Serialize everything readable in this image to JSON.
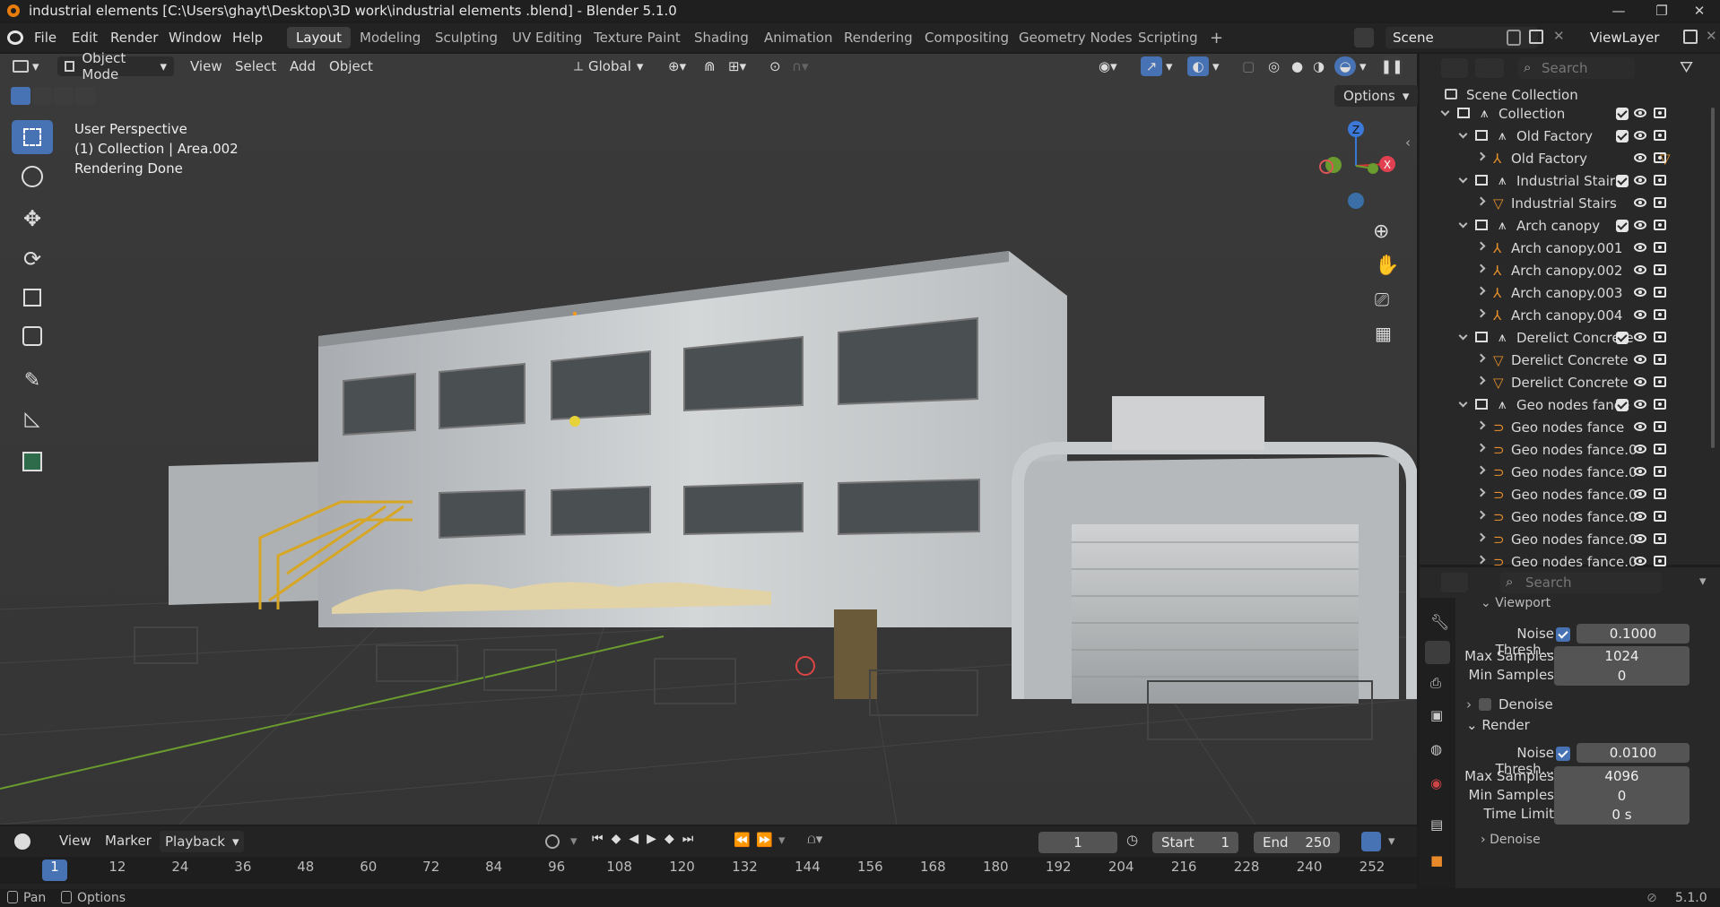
{
  "window": {
    "title": "industrial elements  [C:\\Users\\ghayt\\Desktop\\3D work\\industrial elements .blend] - Blender 5.1.0"
  },
  "menu": [
    "File",
    "Edit",
    "Render",
    "Window",
    "Help"
  ],
  "workspaces": [
    "Layout",
    "Modeling",
    "Sculpting",
    "UV Editing",
    "Texture Paint",
    "Shading",
    "Animation",
    "Rendering",
    "Compositing",
    "Geometry Nodes",
    "Scripting"
  ],
  "active_workspace": "Layout",
  "scene": {
    "name": "Scene",
    "view_layer": "ViewLayer"
  },
  "viewport": {
    "mode": "Object Mode",
    "menus": [
      "View",
      "Select",
      "Add",
      "Object"
    ],
    "orientation": "Global",
    "options_label": "Options",
    "overlay_lines": [
      "User Perspective",
      "(1) Collection | Area.002",
      "Rendering Done"
    ],
    "gizmo": {
      "z": "Z",
      "x": "X"
    }
  },
  "outliner": {
    "search_placeholder": "Search",
    "root": "Scene Collection",
    "rows": [
      {
        "name": "Collection",
        "kind": "collection",
        "level": 0,
        "check": true
      },
      {
        "name": "Old Factory",
        "kind": "collection",
        "level": 1,
        "check": true
      },
      {
        "name": "Old Factory",
        "kind": "armature",
        "level": 2,
        "extra": "modifier-icon"
      },
      {
        "name": "Industrial Stairs",
        "kind": "collection",
        "level": 1,
        "check": true
      },
      {
        "name": "Industrial Stairs",
        "kind": "mesh",
        "level": 2
      },
      {
        "name": "Arch canopy",
        "kind": "collection",
        "level": 1,
        "check": true
      },
      {
        "name": "Arch canopy.001",
        "kind": "armature",
        "level": 2
      },
      {
        "name": "Arch canopy.002",
        "kind": "armature",
        "level": 2
      },
      {
        "name": "Arch canopy.003",
        "kind": "armature",
        "level": 2
      },
      {
        "name": "Arch canopy.004",
        "kind": "armature",
        "level": 2
      },
      {
        "name": "Derelict Concrete",
        "kind": "collection",
        "level": 1,
        "check": true
      },
      {
        "name": "Derelict Concrete",
        "kind": "mesh",
        "level": 2
      },
      {
        "name": "Derelict Concrete",
        "kind": "mesh",
        "level": 2
      },
      {
        "name": "Geo nodes fance",
        "kind": "collection",
        "level": 1,
        "check": true
      },
      {
        "name": "Geo nodes fance",
        "kind": "curve",
        "level": 2
      },
      {
        "name": "Geo nodes fance.0",
        "kind": "curve",
        "level": 2
      },
      {
        "name": "Geo nodes fance.0",
        "kind": "curve",
        "level": 2
      },
      {
        "name": "Geo nodes fance.0",
        "kind": "curve",
        "level": 2
      },
      {
        "name": "Geo nodes fance.0",
        "kind": "curve",
        "level": 2
      },
      {
        "name": "Geo nodes fance.0",
        "kind": "curve",
        "level": 2
      },
      {
        "name": "Geo nodes fance.0",
        "kind": "curve",
        "level": 2
      }
    ]
  },
  "properties": {
    "search_placeholder": "Search",
    "viewport_section": "Viewport",
    "viewport_noise_label": "Noise Thresh...",
    "viewport_noise_value": "0.1000",
    "viewport_max_label": "Max Samples",
    "viewport_max_value": "1024",
    "viewport_min_label": "Min Samples",
    "viewport_min_value": "0",
    "denoise_label": "Denoise",
    "render_section": "Render",
    "render_noise_label": "Noise Thresh...",
    "render_noise_value": "0.0100",
    "render_max_label": "Max Samples",
    "render_max_value": "4096",
    "render_min_label": "Min Samples",
    "render_min_value": "0",
    "time_limit_label": "Time Limit",
    "time_limit_value": "0 s",
    "denoise2_label": "Denoise"
  },
  "timeline": {
    "menus": [
      "View",
      "Marker"
    ],
    "playback": "Playback",
    "current_frame": "1",
    "start_label": "Start",
    "start": "1",
    "end_label": "End",
    "end": "250",
    "ticks": [
      "1",
      "12",
      "24",
      "36",
      "48",
      "60",
      "72",
      "84",
      "96",
      "108",
      "120",
      "132",
      "144",
      "156",
      "168",
      "180",
      "192",
      "204",
      "216",
      "228",
      "240",
      "252"
    ]
  },
  "status": {
    "pan": "Pan",
    "options": "Options",
    "version": "5.1.0"
  }
}
